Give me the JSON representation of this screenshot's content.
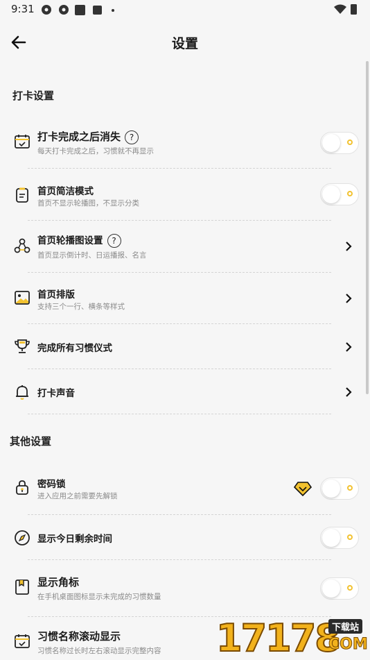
{
  "status_bar": {
    "time": "9:31"
  },
  "header": {
    "title": "设置",
    "back_icon": "arrow-left-icon"
  },
  "sections": [
    {
      "title": "打卡设置",
      "items": [
        {
          "title": "打卡完成之后消失",
          "subtitle": "每天打卡完成之后，习惯就不再显示",
          "icon": "calendar-check-icon",
          "control": "toggle",
          "help": "?",
          "on": false
        },
        {
          "title": "首页简洁模式",
          "subtitle": "首页不显示轮播图，不显示分类",
          "icon": "clipboard-icon",
          "control": "toggle",
          "on": false
        },
        {
          "title": "首页轮播图设置",
          "subtitle": "首页显示倒计时、日运播报、名言",
          "icon": "nodes-icon",
          "control": "chevron",
          "help": "?"
        },
        {
          "title": "首页排版",
          "subtitle": "支持三个一行、横条等样式",
          "icon": "image-icon",
          "control": "chevron"
        },
        {
          "title": "完成所有习惯仪式",
          "subtitle": "",
          "icon": "trophy-icon",
          "control": "chevron"
        },
        {
          "title": "打卡声音",
          "subtitle": "",
          "icon": "bell-icon",
          "control": "chevron"
        }
      ]
    },
    {
      "title": "其他设置",
      "items": [
        {
          "title": "密码锁",
          "subtitle": "进入应用之前需要先解锁",
          "icon": "lock-icon",
          "control": "toggle",
          "vip": true,
          "on": false
        },
        {
          "title": "显示今日剩余时间",
          "subtitle": "",
          "icon": "compass-icon",
          "control": "toggle",
          "on": false
        },
        {
          "title": "显示角标",
          "subtitle": "在手机桌面图标显示未完成的习惯数量",
          "icon": "bookmark-icon",
          "control": "toggle",
          "on": false
        },
        {
          "title": "习惯名称滚动显示",
          "subtitle": "习惯名称过长时左右滚动显示完整内容",
          "icon": "calendar-check-icon",
          "control": "toggle",
          "on": false
        }
      ]
    }
  ],
  "colors": {
    "accent": "#f2c230",
    "background": "#f6f6f6"
  },
  "watermark": {
    "number": "17178",
    "tag": "下载站",
    "suffix": "COM"
  }
}
